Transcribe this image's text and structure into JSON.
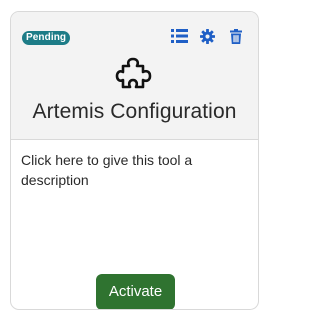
{
  "card": {
    "status_badge": "Pending",
    "tool_name": "Artemis Configuration",
    "description": "Click here to give this tool a description",
    "activate_label": "Activate",
    "icons": {
      "list": "list-icon",
      "settings": "gear-icon",
      "delete": "trash-icon",
      "tool": "puzzle-piece-icon"
    },
    "colors": {
      "badge": "#1d7c87",
      "toolbar_icons": "#1f5fc6",
      "activate_button": "#2f7330",
      "header_bg": "#f3f3f3"
    }
  }
}
